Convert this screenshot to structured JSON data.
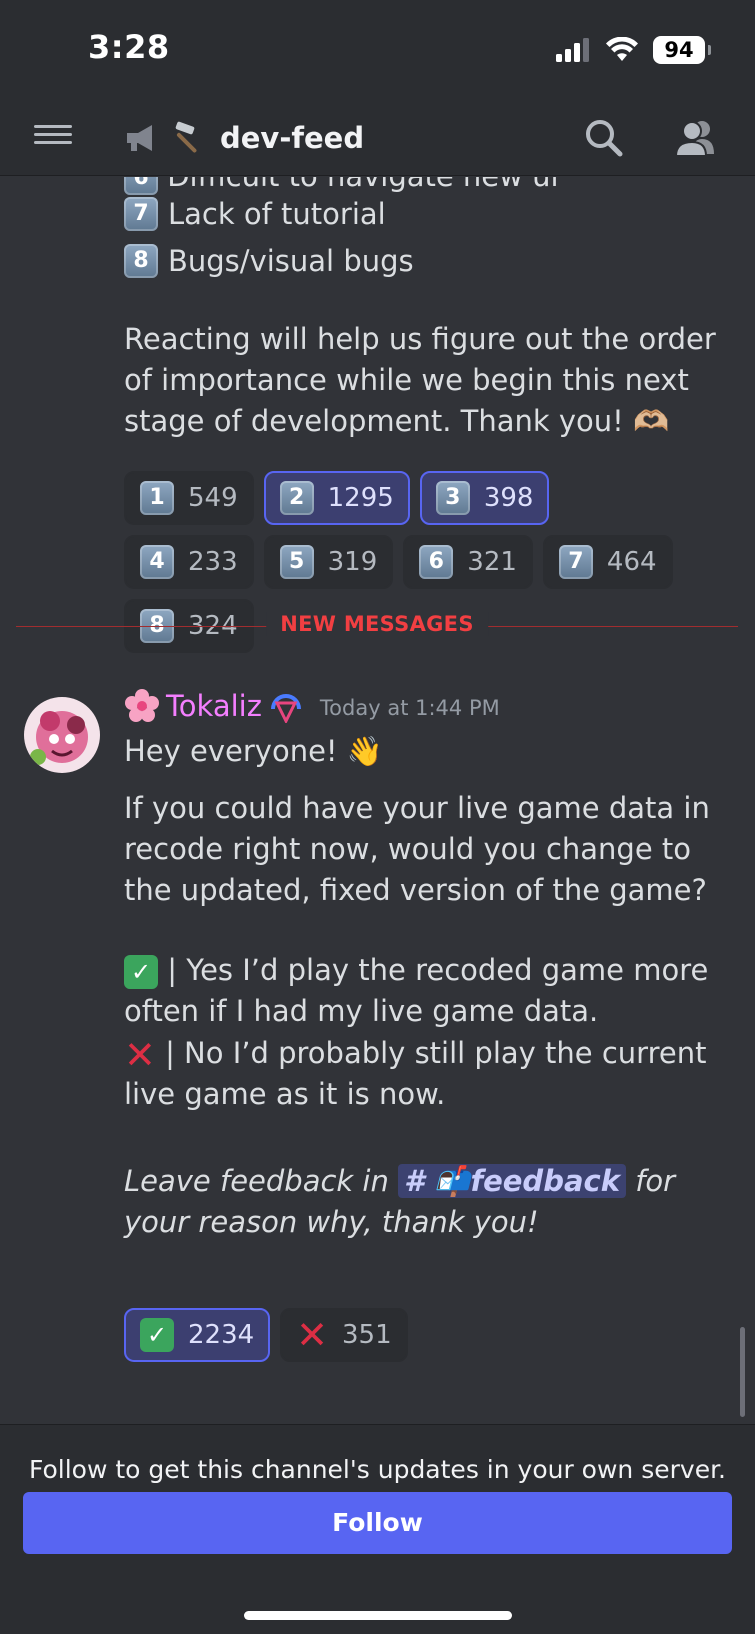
{
  "status": {
    "time": "3:28",
    "battery": "94"
  },
  "header": {
    "channel_name": "dev-feed"
  },
  "previous_message": {
    "cut_line": "Difficult to navigate new ui",
    "items": [
      {
        "key": "7",
        "text": "Lack of tutorial"
      },
      {
        "key": "8",
        "text": "Bugs/visual bugs"
      }
    ],
    "paragraph": "Reacting will help us figure out the order of importance while we begin this next stage of development. Thank you! 🫶🏼",
    "reactions": [
      {
        "key": "1",
        "count": "549",
        "me": false
      },
      {
        "key": "2",
        "count": "1295",
        "me": true
      },
      {
        "key": "3",
        "count": "398",
        "me": true
      },
      {
        "key": "4",
        "count": "233",
        "me": false
      },
      {
        "key": "5",
        "count": "319",
        "me": false
      },
      {
        "key": "6",
        "count": "321",
        "me": false
      },
      {
        "key": "7",
        "count": "464",
        "me": false
      },
      {
        "key": "8",
        "count": "324",
        "me": false
      }
    ]
  },
  "divider": {
    "label": "NEW MESSAGES"
  },
  "message": {
    "username": "Tokaliz",
    "timestamp": "Today at 1:44 PM",
    "greeting": "Hey everyone! 👋",
    "question": "If you could have your live game data in recode right now, would you change to the updated, fixed version of the game?",
    "option_yes": "| Yes I’d play the recoded game more often if I had my live game data.",
    "option_no": "| No I’d probably still play the current live game as it is now.",
    "feedback_prefix": "Leave feedback in",
    "feedback_channel": "# 📬feedback",
    "feedback_suffix": "for your reason why, thank you!",
    "reactions": [
      {
        "emoji": "check",
        "count": "2234",
        "me": true
      },
      {
        "emoji": "cross",
        "count": "351",
        "me": false
      }
    ]
  },
  "footer": {
    "text": "Follow to get this channel's updates in your own server.",
    "button_label": "Follow"
  },
  "colors": {
    "accent": "#5865f2",
    "new_messages": "#f23f42",
    "username": "#f47fff"
  }
}
